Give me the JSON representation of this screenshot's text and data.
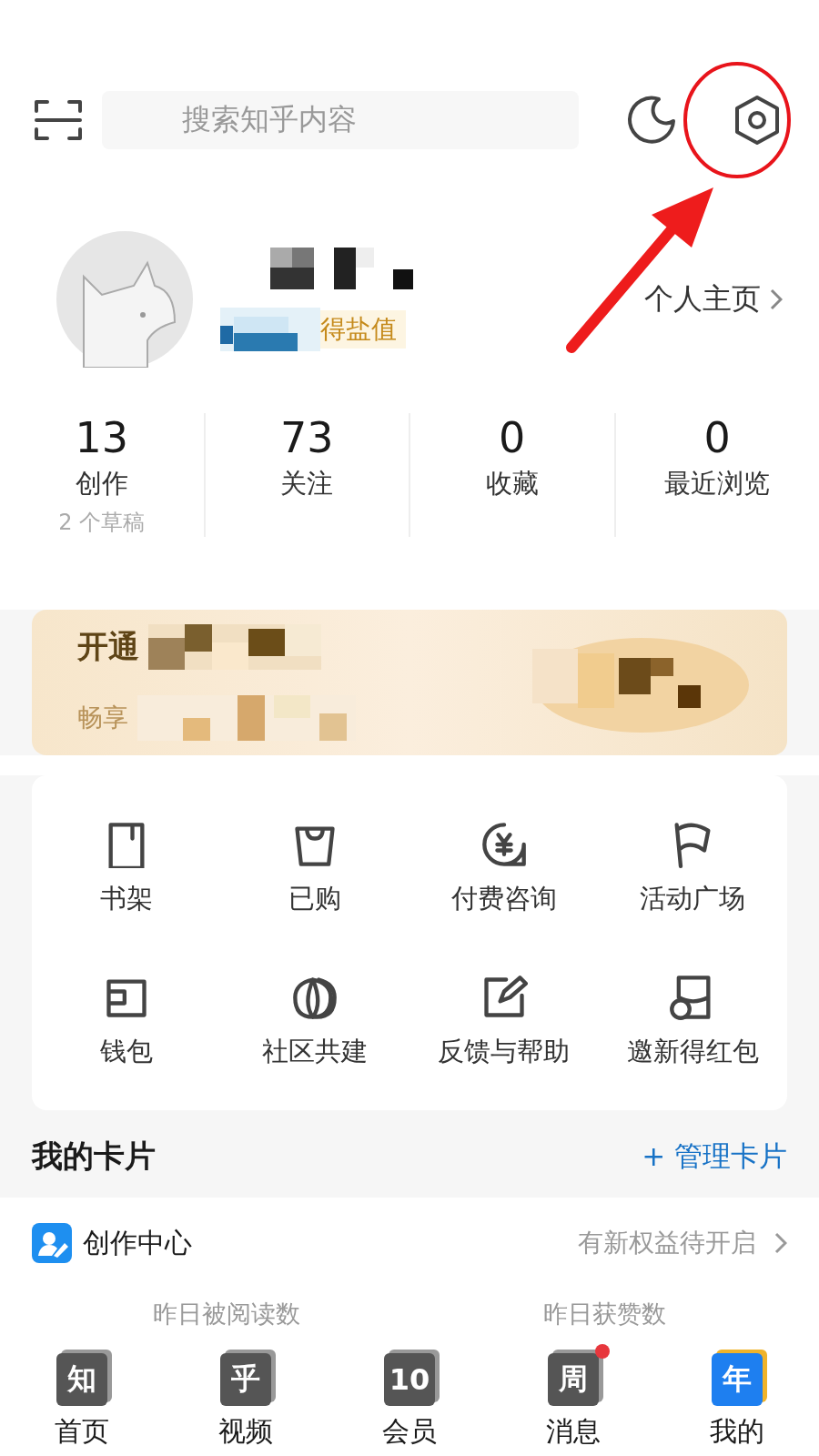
{
  "top_bar": {
    "search": {
      "placeholder": "搜索知乎内容"
    }
  },
  "profile": {
    "badge_text": "得盐值",
    "homepage_link": "个人主页"
  },
  "stats": [
    {
      "value": "13",
      "label": "创作",
      "note": "2 个草稿"
    },
    {
      "value": "73",
      "label": "关注"
    },
    {
      "value": "0",
      "label": "收藏"
    },
    {
      "value": "0",
      "label": "最近浏览"
    }
  ],
  "vip_banner": {
    "title": "开通",
    "subtitle": "畅享"
  },
  "shortcuts": [
    {
      "label": "书架"
    },
    {
      "label": "已购"
    },
    {
      "label": "付费咨询"
    },
    {
      "label": "活动广场"
    },
    {
      "label": "钱包"
    },
    {
      "label": "社区共建"
    },
    {
      "label": "反馈与帮助"
    },
    {
      "label": "邀新得红包"
    }
  ],
  "cards": {
    "title": "我的卡片",
    "manage": "+ 管理卡片",
    "creator": {
      "title": "创作中心",
      "hint": "有新权益待开启",
      "metrics": [
        "昨日被阅读数",
        "昨日获赞数"
      ]
    }
  },
  "tab_bar": [
    {
      "label": "首页",
      "glyph": "知",
      "selected": false,
      "dot": false
    },
    {
      "label": "视频",
      "glyph": "乎",
      "selected": false,
      "dot": false
    },
    {
      "label": "会员",
      "glyph": "10",
      "selected": false,
      "dot": false
    },
    {
      "label": "消息",
      "glyph": "周",
      "selected": false,
      "dot": true
    },
    {
      "label": "我的",
      "glyph": "年",
      "selected": true,
      "dot": false
    }
  ]
}
